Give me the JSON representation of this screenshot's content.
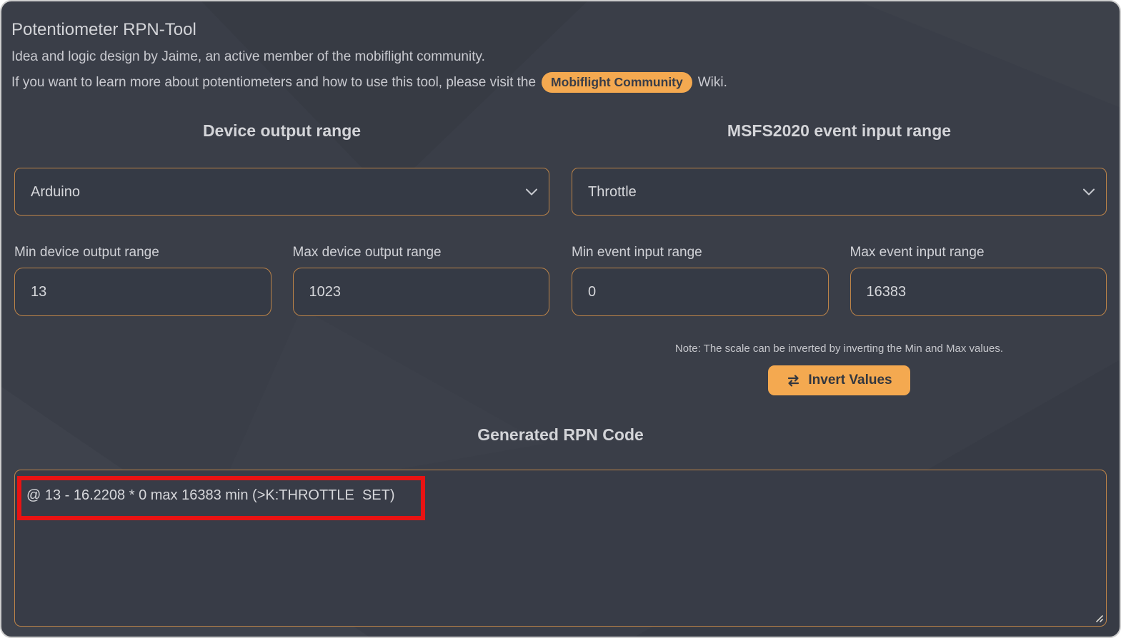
{
  "page": {
    "title": "Potentiometer RPN-Tool",
    "subtitle": "Idea and logic design by Jaime, an active member of the mobiflight community.",
    "info_prefix": "If you want to learn more about potentiometers and how to use this tool, please visit the",
    "info_badge": "Mobiflight Community",
    "info_suffix": "Wiki."
  },
  "device_section": {
    "heading": "Device output range",
    "select_value": "Arduino",
    "min_label": "Min device output range",
    "min_value": "13",
    "max_label": "Max device output range",
    "max_value": "1023"
  },
  "event_section": {
    "heading": "MSFS2020 event input range",
    "select_value": "Throttle",
    "min_label": "Min event input range",
    "min_value": "0",
    "max_label": "Max event input range",
    "max_value": "16383",
    "note": "Note: The scale can be inverted by inverting the Min and Max values.",
    "invert_button_label": "Invert Values"
  },
  "rpn_section": {
    "heading": "Generated RPN Code",
    "code": "@ 13 - 16.2208 * 0 max 16383 min (>K:THROTTLE  SET)"
  },
  "icons": {
    "chevron_down": "⌄",
    "swap_arrows": "⇄",
    "resize_grip": "◿"
  },
  "colors": {
    "background": "#3a3e48",
    "control_background": "#353a45",
    "accent_orange": "#f4a950",
    "border_orange": "#bd8448",
    "highlight_red": "#e81313",
    "text_light": "#d3d4d8"
  }
}
